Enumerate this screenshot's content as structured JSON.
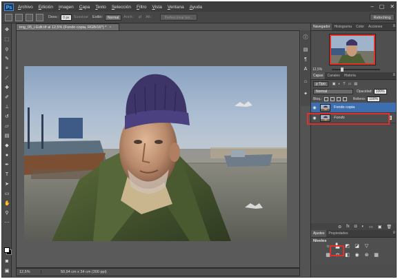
{
  "app": {
    "logo_text": "Ps"
  },
  "menu": [
    "Archivo",
    "Edición",
    "Imagen",
    "Capa",
    "Texto",
    "Selección",
    "Filtro",
    "Vista",
    "Ventana",
    "Ayuda"
  ],
  "window_controls": [
    "–",
    "▢",
    "✕"
  ],
  "options_bar": {
    "feather_label": "Desv.:",
    "feather_value": "0 px",
    "smooth_label": "Suavizar",
    "style_label": "Estilo:",
    "style_value": "Normal",
    "width_label": "Anch.:",
    "height_label": "Alt.:",
    "refine_button": "Perfeccionar bor...",
    "workspace": "Retoching"
  },
  "document": {
    "tab_title": "img_05_i-Edit.tif al 12,5% (Fondo copia, RGB/16*) *",
    "tab_close": "×",
    "status_zoom": "12,5%",
    "status_size": "50,94 cm x 34 cm (300 ppi)"
  },
  "navigator": {
    "tabs": [
      "Navegador",
      "Histograma",
      "Color",
      "Acciones"
    ],
    "zoom": "12,5%",
    "zoom_level": 0.2
  },
  "layers_panel": {
    "tabs": [
      "Capas",
      "Canales",
      "Historia"
    ],
    "filter_label": "ρ Tipo",
    "blend_mode": "Normal",
    "opacity_label": "Opacidad:",
    "opacity_value": "100%",
    "lock_label": "Bloq.:",
    "fill_label": "Relleno:",
    "fill_value": "100%",
    "layers": [
      {
        "name": "Fondo copia",
        "selected": true
      },
      {
        "name": "Fondo",
        "selected": false,
        "locked": true
      }
    ],
    "footer_icons": [
      "⊖",
      "fx",
      "◘",
      "◐",
      "▭",
      "▣",
      "🗑"
    ]
  },
  "adjustments": {
    "tabs": [
      "Ajustes",
      "Propiedades"
    ],
    "title": "Niveles"
  },
  "colors": {
    "highlight": "#e0312b",
    "selected_layer": "#3d6fb0"
  }
}
